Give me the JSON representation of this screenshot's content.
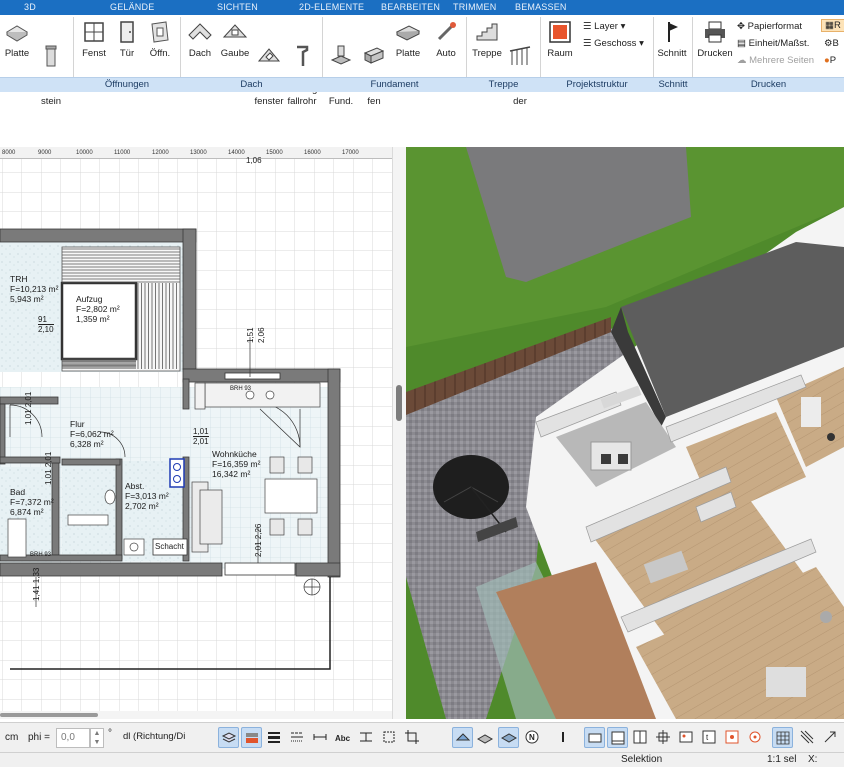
{
  "tabs": [
    "3D",
    "GELÄNDE",
    "SICHTEN",
    "2D-ELEMENTE",
    "BEARBEITEN",
    "TRIMMEN",
    "BEMASSEN"
  ],
  "ribbon": {
    "buttons": [
      {
        "name": "platte-button",
        "label": "Platte",
        "icon": "slab-icon"
      },
      {
        "name": "schornstein-button",
        "label": "Schorn-\nstein",
        "icon": "chimney-icon"
      },
      {
        "name": "fenster-button",
        "label": "Fenst",
        "icon": "window-icon"
      },
      {
        "name": "tuer-button",
        "label": "Tür",
        "icon": "door-icon"
      },
      {
        "name": "oeffnung-button",
        "label": "Öffn.",
        "icon": "opening-icon"
      },
      {
        "name": "dach-button",
        "label": "Dach",
        "icon": "roof-icon"
      },
      {
        "name": "gaube-button",
        "label": "Gaube",
        "icon": "dormer-icon"
      },
      {
        "name": "dachfenster-button",
        "label": "Dach-\nfenster",
        "icon": "roof-window-icon"
      },
      {
        "name": "regenfallrohr-button",
        "label": "Regen-\nfallrohr",
        "icon": "downpipe-icon"
      },
      {
        "name": "einzelfundament-button",
        "label": "Einzel\nFund.",
        "icon": "single-foundation-icon"
      },
      {
        "name": "streifenfundament-button",
        "label": "Strei-\nfen",
        "icon": "strip-foundation-icon"
      },
      {
        "name": "fundamentplatte-button",
        "label": "Platte",
        "icon": "foundation-slab-icon"
      },
      {
        "name": "auto-button",
        "label": "Auto",
        "icon": "auto-wand-icon"
      },
      {
        "name": "treppe-button",
        "label": "Treppe",
        "icon": "stairs-icon"
      },
      {
        "name": "gelaender-button",
        "label": "Gelän-\nder",
        "icon": "railing-icon"
      },
      {
        "name": "raum-button",
        "label": "Raum",
        "icon": "room-icon"
      },
      {
        "name": "schnitt-button",
        "label": "Schnitt",
        "icon": "section-flag-icon"
      },
      {
        "name": "drucken-button",
        "label": "Drucken",
        "icon": "printer-icon"
      }
    ],
    "layer_label": "Layer",
    "geschoss_label": "Geschoss",
    "papierformat_label": "Papierformat",
    "einheit_label": "Einheit/Maßst.",
    "mehrere_seiten_label": "Mehrere Seiten",
    "right_cut_1": "R",
    "right_cut_2": "B",
    "right_cut_3": "P"
  },
  "groups": [
    "Öffnungen",
    "Dach",
    "Fundament",
    "Treppe",
    "Projektstruktur",
    "Schnitt",
    "Drucken"
  ],
  "ruler_ticks": [
    "8000",
    "9000",
    "10000",
    "11000",
    "12000",
    "13000",
    "14000",
    "15000",
    "16000",
    "17000"
  ],
  "plan": {
    "rooms": [
      {
        "name": "TRH",
        "area1": "F=10,213 m²",
        "area2": "5,943 m²"
      },
      {
        "name": "Aufzug",
        "area1": "F=2,802 m²",
        "area2": "1,359 m²"
      },
      {
        "name": "Flur",
        "area1": "F=6,062 m²",
        "area2": "6,328 m²"
      },
      {
        "name": "Wohnküche",
        "area1": "F=16,359 m²",
        "area2": "16,342 m²"
      },
      {
        "name": "Bad",
        "area1": "F=7,372 m²",
        "area2": "6,874 m²"
      },
      {
        "name": "Abst.",
        "area1": "F=3,013 m²",
        "area2": "2,702 m²"
      }
    ],
    "schacht_label": "Schacht",
    "brh_label_1": "BRH 93",
    "brh_label_2": "BRH 93",
    "dims": {
      "d_91_210": [
        "91",
        "2,10"
      ],
      "d_151_206": [
        "1,51",
        "2,06"
      ],
      "d_101_201": [
        "1,01",
        "2,01"
      ],
      "d_101_201_b": [
        "1,01",
        "2,01"
      ],
      "d_101_201_c": [
        "1,01",
        "2,01"
      ],
      "d_201_226": [
        "2,01",
        "2,26"
      ],
      "d_141_133": [
        "1,41",
        "1,33"
      ],
      "d_top": "1,06"
    }
  },
  "bottom": {
    "unit": "cm",
    "phi_label": "phi =",
    "phi_value": "0,0",
    "degree": "°",
    "dl_value": "dl (Richtung/Di"
  },
  "status": {
    "mode": "Selektion",
    "scale": "1:1 sel",
    "x_label": "X:"
  },
  "colors": {
    "accent": "#1b6fc2",
    "group_strip": "#cfe2f6",
    "grass": "#4f8a2b",
    "wall_plan": "#7a7a7a"
  }
}
